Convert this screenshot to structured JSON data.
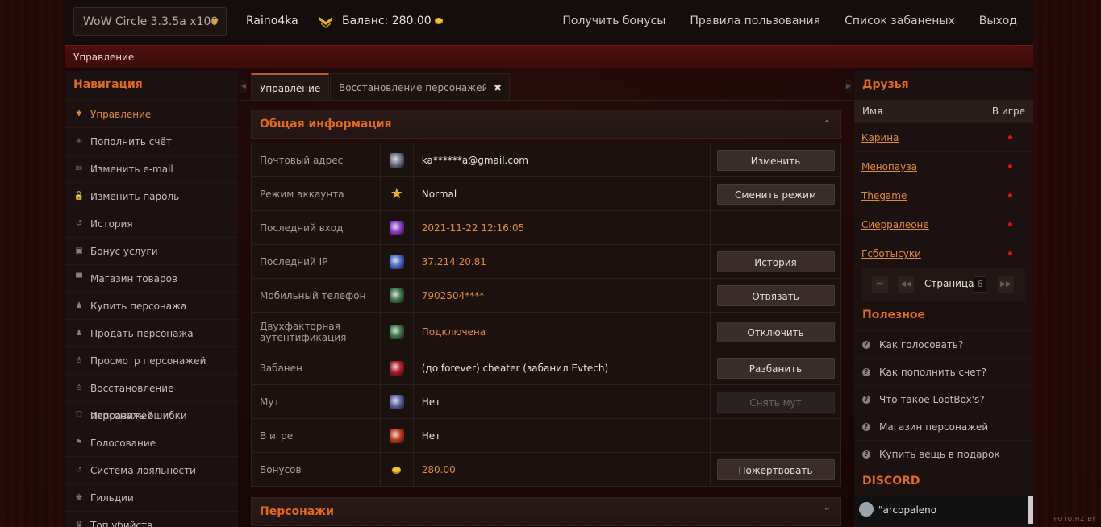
{
  "topbar": {
    "server": "WoW Circle 3.3.5a x100",
    "username": "Raino4ka",
    "balance_label": "Баланс: 280.00",
    "nav": [
      "Получить бонусы",
      "Правила пользования",
      "Список забаненых",
      "Выход"
    ]
  },
  "breadcrumb": "Управление",
  "leftnav": {
    "title": "Навигация",
    "items": [
      {
        "label": "Управление",
        "icon": "gear-icon",
        "glyph": "✱"
      },
      {
        "label": "Пополнить счёт",
        "icon": "plus-circle-icon",
        "glyph": "⊕"
      },
      {
        "label": "Изменить e-mail",
        "icon": "envelope-icon",
        "glyph": "✉"
      },
      {
        "label": "Изменить пароль",
        "icon": "lock-icon",
        "glyph": "🔓"
      },
      {
        "label": "История",
        "icon": "history-icon",
        "glyph": "↺"
      },
      {
        "label": "Бонус услуги",
        "icon": "bonus-icon",
        "glyph": "▣"
      },
      {
        "label": "Магазин товаров",
        "icon": "cart-icon",
        "glyph": "▀"
      },
      {
        "label": "Купить персонажа",
        "icon": "user-icon",
        "glyph": "♟"
      },
      {
        "label": "Продать персонажа",
        "icon": "user-icon",
        "glyph": "♟"
      },
      {
        "label": "Просмотр персонажей",
        "icon": "person-icon",
        "glyph": "♙"
      },
      {
        "label": "Восстановление персонажей",
        "icon": "person-icon",
        "glyph": "♙"
      },
      {
        "label": "Исправить ошибки",
        "icon": "shield-icon",
        "glyph": "⛉"
      },
      {
        "label": "Голосование",
        "icon": "flag-icon",
        "glyph": "⚑"
      },
      {
        "label": "Система лояльности",
        "icon": "history-icon",
        "glyph": "↺"
      },
      {
        "label": "Гильдии",
        "icon": "users-icon",
        "glyph": "♚"
      },
      {
        "label": "Топ убийств",
        "icon": "trophy-icon",
        "glyph": "♛"
      }
    ]
  },
  "tabs": [
    {
      "label": "Управление",
      "active": true
    },
    {
      "label": "Восстановление персонажей",
      "active": false
    }
  ],
  "section_info": {
    "title": "Общая информация",
    "rows": [
      {
        "label": "Почтовый адрес",
        "value": "ka******a@gmail.com",
        "orange": false,
        "action": "Изменить",
        "disabled": false,
        "icon": "mail-icon",
        "color": "#6f7a8f"
      },
      {
        "label": "Режим аккаунта",
        "value": "Normal",
        "orange": false,
        "action": "Сменить режим",
        "disabled": false,
        "icon": "star-icon",
        "color": "#e8b320"
      },
      {
        "label": "Последний вход",
        "value": "2021-11-22 12:16:05",
        "orange": true,
        "action": "",
        "disabled": false,
        "icon": "magic-icon",
        "color": "#8e3bd1"
      },
      {
        "label": "Последний IP",
        "value": "37.214.20.81",
        "orange": true,
        "action": "История",
        "disabled": false,
        "icon": "network-icon",
        "color": "#4b6ecf"
      },
      {
        "label": "Мобильный телефон",
        "value": "7902504****",
        "orange": true,
        "action": "Отвязать",
        "disabled": false,
        "icon": "phone-icon",
        "color": "#3c7a4a"
      },
      {
        "label": "Двухфакторная аутентификация",
        "value": "Подключена",
        "orange": true,
        "action": "Отключить",
        "disabled": false,
        "icon": "phone-icon",
        "color": "#3c7a4a"
      },
      {
        "label": "Забанен",
        "value": "(до forever) cheater (забанил Evtech)",
        "orange": false,
        "action": "Разбанить",
        "disabled": false,
        "icon": "ban-icon",
        "color": "#b11d2a"
      },
      {
        "label": "Мут",
        "value": "Нет",
        "orange": false,
        "action": "Снять мут",
        "disabled": true,
        "icon": "mute-icon",
        "color": "#5a66a8"
      },
      {
        "label": "В игре",
        "value": "Нет",
        "orange": false,
        "action": "",
        "disabled": false,
        "icon": "ingame-icon",
        "color": "#c73a16"
      },
      {
        "label": "Бонусов",
        "value": "280.00",
        "orange": true,
        "action": "Пожертвовать",
        "disabled": false,
        "icon": "coin-icon",
        "color": "#f1c232"
      }
    ]
  },
  "section_chars": {
    "title": "Персонажи"
  },
  "friends": {
    "title": "Друзья",
    "col_name": "Имя",
    "col_online": "В игре",
    "list": [
      "Карина",
      "Менопауза",
      "Thegame",
      "Сиерралеоне",
      "Гсботысуки"
    ],
    "page_label": "Страница",
    "page_value": "6"
  },
  "useful": {
    "title": "Полезное",
    "items": [
      "Как голосовать?",
      "Как пополнить счет?",
      "Что такое LootBox's?",
      "Магазин персонажей",
      "Купить вещь в подарок"
    ]
  },
  "discord": {
    "title": "DISCORD",
    "user": "\"arcopaleno"
  },
  "watermark": "FOTO.HZ.BY"
}
